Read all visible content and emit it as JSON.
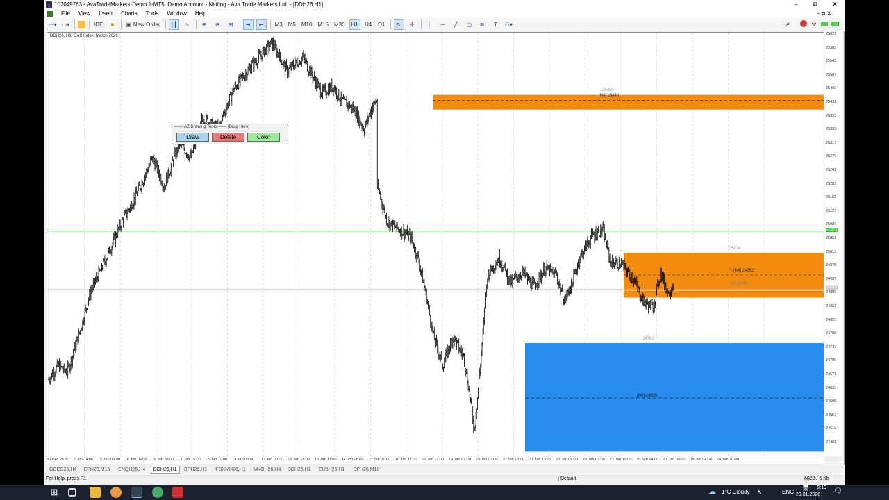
{
  "window": {
    "title": "107049763 - AvaTradeMarkets-Demo 1-MT5: Demo Account - Netting - Ava Trade Markets Ltd. - [DDH26,H1]",
    "controls": [
      "–",
      "⧉",
      "✕"
    ]
  },
  "menu": [
    "File",
    "View",
    "Insert",
    "Charts",
    "Tools",
    "Window",
    "Help"
  ],
  "toolbar": {
    "ide": "IDE",
    "new_order": "New Order",
    "timeframes": [
      "M3",
      "M5",
      "M10",
      "M15",
      "M30",
      "H1",
      "H4",
      "D1"
    ],
    "active_timeframe": "H1"
  },
  "chart": {
    "info": "DDH26, H1:  DAX Index: March 2026",
    "symbol": "DDH26",
    "timeframe": "H1",
    "orange_zone_top": {
      "high": 25455,
      "low": 25414,
      "label": "[H4]  25440",
      "price_label": "25455",
      "color": "#f28c0f"
    },
    "orange_zone_mid": {
      "high": 25014,
      "low": 24889,
      "label": "[H4]  24952",
      "price_label": "25014",
      "timer": "00:40:09",
      "color": "#f28c0f"
    },
    "blue_zone": {
      "high": 24762,
      "low": 24459,
      "label": "[H4]  24609",
      "price_label": "24762",
      "color": "#2a8cec"
    },
    "green_line": {
      "price": 25075,
      "color": "#22cc22"
    },
    "current_price_label": "24913",
    "price_labels": [
      "25621",
      "25583",
      "25545",
      "25507",
      "25469",
      "25431",
      "25393",
      "25355",
      "25317",
      "25279",
      "25241",
      "25203",
      "25165",
      "25127",
      "25089",
      "25051",
      "25013",
      "24975",
      "24937",
      "24899",
      "24861",
      "24823",
      "24785",
      "24747",
      "24709",
      "24671",
      "24633",
      "24595",
      "24557",
      "24519",
      "24481"
    ],
    "time_labels": [
      "30 Dec 2025",
      "2 Jan 14:00",
      "5 Jan 09:00",
      "6 Jan 04:00",
      "6 Jan 20:00",
      "7 Jan 15:00",
      "8 Jan 10:00",
      "9 Jan 05:00",
      "12 Jan 00:00",
      "12 Jan 16:00",
      "13 Jan 11:00",
      "14 Jan 06:00",
      "15 Jan 01:00",
      "15 Jan 17:00",
      "16 Jan 12:00",
      "19 Jan 07:00",
      "20 Jan 02:00",
      "20 Jan 18:00",
      "21 Jan 13:00",
      "22 Jan 08:00",
      "23 Jan 03:00",
      "23 Jan 19:00",
      "26 Jan 14:00",
      "27 Jan 09:00",
      "28 Jan 04:00",
      "28 Jan 20:00"
    ]
  },
  "draw_panel": {
    "header": "═══ AZ Drawing Tools ═══ [Drag Here]",
    "draw": "Draw",
    "delete": "Delete",
    "color": "Color"
  },
  "tabs": [
    "GCEG26,H4",
    "EPH26,M15",
    "ENQH26,H4",
    "DDH26,H1",
    "BPH26,H1",
    "FDXMH26,H1",
    "MNQH26,H4",
    "DDH26,H1",
    "EU6H26,H1",
    "EPH26,M10"
  ],
  "active_tab": 3,
  "status": {
    "help": "For Help, press F1",
    "profile": "Default",
    "traffic": "6028 / 6 Kb"
  },
  "taskbar": {
    "weather": "1°C  Cloudy",
    "lang": "ENG",
    "time": "9:19",
    "date": "29.01.2026"
  }
}
